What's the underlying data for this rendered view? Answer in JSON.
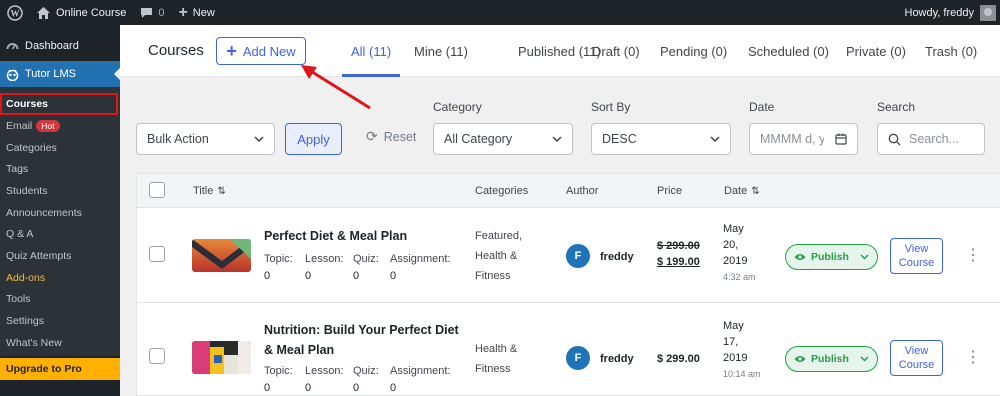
{
  "adminbar": {
    "site_name": "Online Course",
    "comments_count": "0",
    "new_label": "New",
    "howdy": "Howdy, freddy"
  },
  "sidebar": {
    "dashboard": "Dashboard",
    "tutor": "Tutor LMS",
    "items": [
      {
        "label": "Courses"
      },
      {
        "label": "Email",
        "badge": "Hot"
      },
      {
        "label": "Categories"
      },
      {
        "label": "Tags"
      },
      {
        "label": "Students"
      },
      {
        "label": "Announcements"
      },
      {
        "label": "Q & A"
      },
      {
        "label": "Quiz Attempts"
      },
      {
        "label": "Add-ons"
      },
      {
        "label": "Tools"
      },
      {
        "label": "Settings"
      },
      {
        "label": "What's New"
      }
    ],
    "upgrade": "Upgrade to Pro"
  },
  "header": {
    "title": "Courses",
    "add_new": "Add New",
    "tabs": [
      {
        "label": "All (11)"
      },
      {
        "label": "Mine (11)"
      },
      {
        "label": "Published (11)"
      },
      {
        "label": "Draft (0)"
      },
      {
        "label": "Pending (0)"
      },
      {
        "label": "Scheduled (0)"
      },
      {
        "label": "Private (0)"
      },
      {
        "label": "Trash (0)"
      }
    ]
  },
  "filters": {
    "bulk_action": "Bulk Action",
    "apply": "Apply",
    "reset": "Reset",
    "category_label": "Category",
    "category_value": "All Category",
    "sort_label": "Sort By",
    "sort_value": "DESC",
    "date_label": "Date",
    "date_placeholder": "MMMM d, y",
    "search_label": "Search",
    "search_placeholder": "Search..."
  },
  "table": {
    "headers": {
      "title": "Title",
      "categories": "Categories",
      "author": "Author",
      "price": "Price",
      "date": "Date"
    },
    "rows": [
      {
        "title_line1": "Perfect Diet & Meal Plan",
        "title_line2": "",
        "meta_labels": [
          "Topic:",
          "Lesson:",
          "Quiz:",
          "Assignment:"
        ],
        "meta_values": [
          "0",
          "0",
          "0",
          "0"
        ],
        "categories": [
          "Featured,",
          "Health &",
          "Fitness"
        ],
        "author_initial": "F",
        "author": "freddy",
        "price_old": "$ 299.00",
        "price_new": "$ 199.00",
        "date_lines": [
          "May",
          "20,",
          "2019"
        ],
        "time": "4:32 am",
        "status": "Publish",
        "view_line1": "View",
        "view_line2": "Course"
      },
      {
        "title_line1": "Nutrition: Build Your Perfect Diet",
        "title_line2": "& Meal Plan",
        "meta_labels": [
          "Topic:",
          "Lesson:",
          "Quiz:",
          "Assignment:"
        ],
        "meta_values": [
          "0",
          "0",
          "0",
          "0"
        ],
        "categories": [
          "Health &",
          "Fitness"
        ],
        "author_initial": "F",
        "author": "freddy",
        "price": "$ 299.00",
        "date_lines": [
          "May",
          "17,",
          "2019"
        ],
        "time": "10:14 am",
        "status": "Publish",
        "view_line1": "View",
        "view_line2": "Course"
      }
    ]
  },
  "colors": {
    "accent": "#3e64de",
    "wp_blue": "#2271b1",
    "publish_green": "#24a148",
    "highlight_red": "#e0151a",
    "upgrade": "#ffb000"
  }
}
